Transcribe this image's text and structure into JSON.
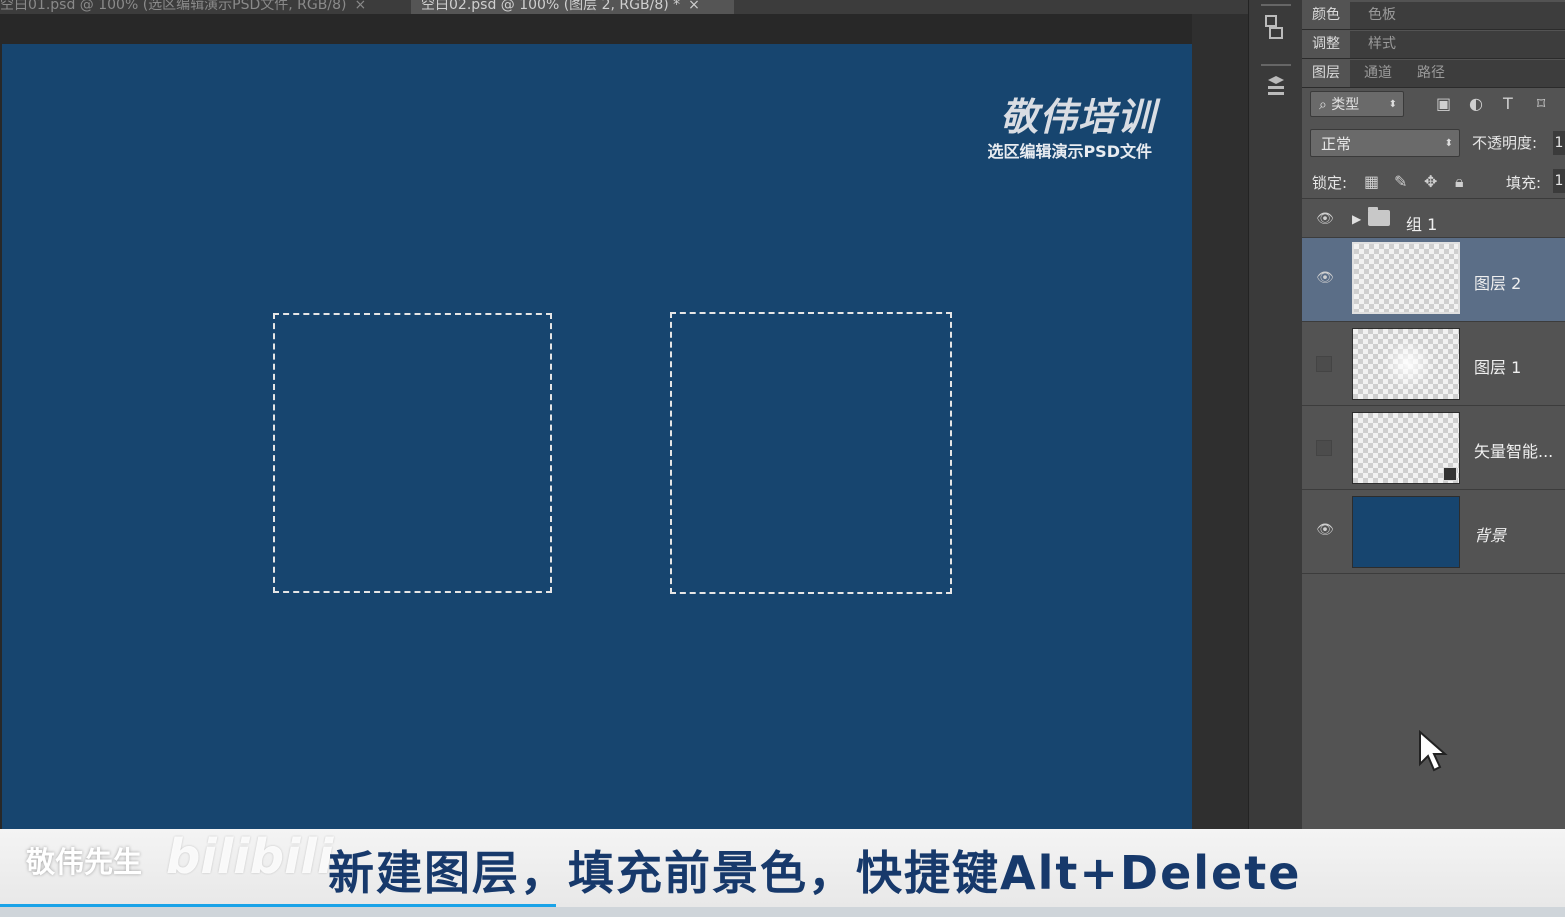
{
  "doc_tabs": [
    {
      "label": "空白01.psd @ 100% (选区编辑演示PSD文件, RGB/8)",
      "close": "×"
    },
    {
      "label": "空白02.psd @ 100% (图层 2, RGB/8) *",
      "close": "×"
    }
  ],
  "canvas": {
    "brand_title": "敬伟培训",
    "brand_subtitle": "选区编辑演示PSD文件",
    "background_color": "#17456f"
  },
  "panel": {
    "tab_row_1": [
      "颜色",
      "色板"
    ],
    "tab_row_2": [
      "调整",
      "样式"
    ],
    "tab_row_3": [
      "图层",
      "通道",
      "路径"
    ],
    "filter_kind": "类型",
    "blend_mode": "正常",
    "opacity_label": "不透明度:",
    "opacity_value": "1",
    "lock_label": "锁定:",
    "fill_label": "填充:",
    "fill_value": "1",
    "layers": [
      {
        "name": "组 1",
        "type": "group",
        "visible": true
      },
      {
        "name": "图层 2",
        "type": "layer",
        "visible": true,
        "selected": true
      },
      {
        "name": "图层 1",
        "type": "layer",
        "visible": false
      },
      {
        "name": "矢量智能...",
        "type": "smart-object",
        "visible": false
      },
      {
        "name": "背景",
        "type": "background",
        "visible": true
      }
    ]
  },
  "subtitle": {
    "brand": "敬伟先生",
    "platform": "bilibili",
    "text": "新建图层，填充前景色，快捷键Alt+Delete"
  }
}
